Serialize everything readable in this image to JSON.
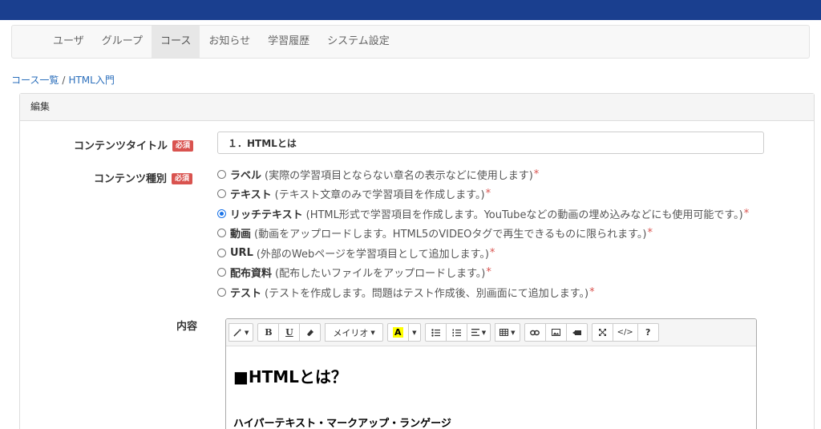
{
  "nav": {
    "tabs": [
      {
        "label": "ユーザ"
      },
      {
        "label": "グループ"
      },
      {
        "label": "コース",
        "active": true
      },
      {
        "label": "お知らせ"
      },
      {
        "label": "学習履歴"
      },
      {
        "label": "システム設定"
      }
    ]
  },
  "breadcrumb": {
    "course_list": "コース一覧",
    "separator": "/",
    "current": "HTML入門"
  },
  "panel": {
    "heading": "編集"
  },
  "form": {
    "title_label": "コンテンツタイトル",
    "required_badge": "必須",
    "title_value": "１．HTMLとは",
    "type_label": "コンテンツ種別",
    "content_label": "内容",
    "types": [
      {
        "name": "ラベル",
        "desc": "(実際の学習項目とならない章名の表示などに使用します)",
        "star": "*",
        "checked": false
      },
      {
        "name": "テキスト",
        "desc": "(テキスト文章のみで学習項目を作成します。)",
        "star": "*",
        "checked": false
      },
      {
        "name": "リッチテキスト",
        "desc": "(HTML形式で学習項目を作成します。YouTubeなどの動画の埋め込みなどにも使用可能です。)",
        "star": "*",
        "checked": true
      },
      {
        "name": "動画",
        "desc": "(動画をアップロードします。HTML5のVIDEOタグで再生できるものに限られます。)",
        "star": "*",
        "checked": false
      },
      {
        "name": "URL",
        "desc": "(外部のWebページを学習項目として追加します。)",
        "star": "*",
        "checked": false
      },
      {
        "name": "配布資料",
        "desc": "(配布したいファイルをアップロードします。)",
        "star": "*",
        "checked": false
      },
      {
        "name": "テスト",
        "desc": "(テストを作成します。問題はテスト作成後、別画面にて追加します。)",
        "star": "*",
        "checked": false
      }
    ]
  },
  "editor": {
    "font_name": "メイリオ",
    "bold": "B",
    "underline": "U",
    "highlight": "A",
    "help": "?",
    "code": "</>",
    "heading1": "■HTMLとは？",
    "heading2": "ハイパーテキスト・マークアップ・ランゲージ"
  },
  "colors": {
    "topbar": "#1a3f8f",
    "required": "#d9534f",
    "link": "#2a6ebb"
  }
}
